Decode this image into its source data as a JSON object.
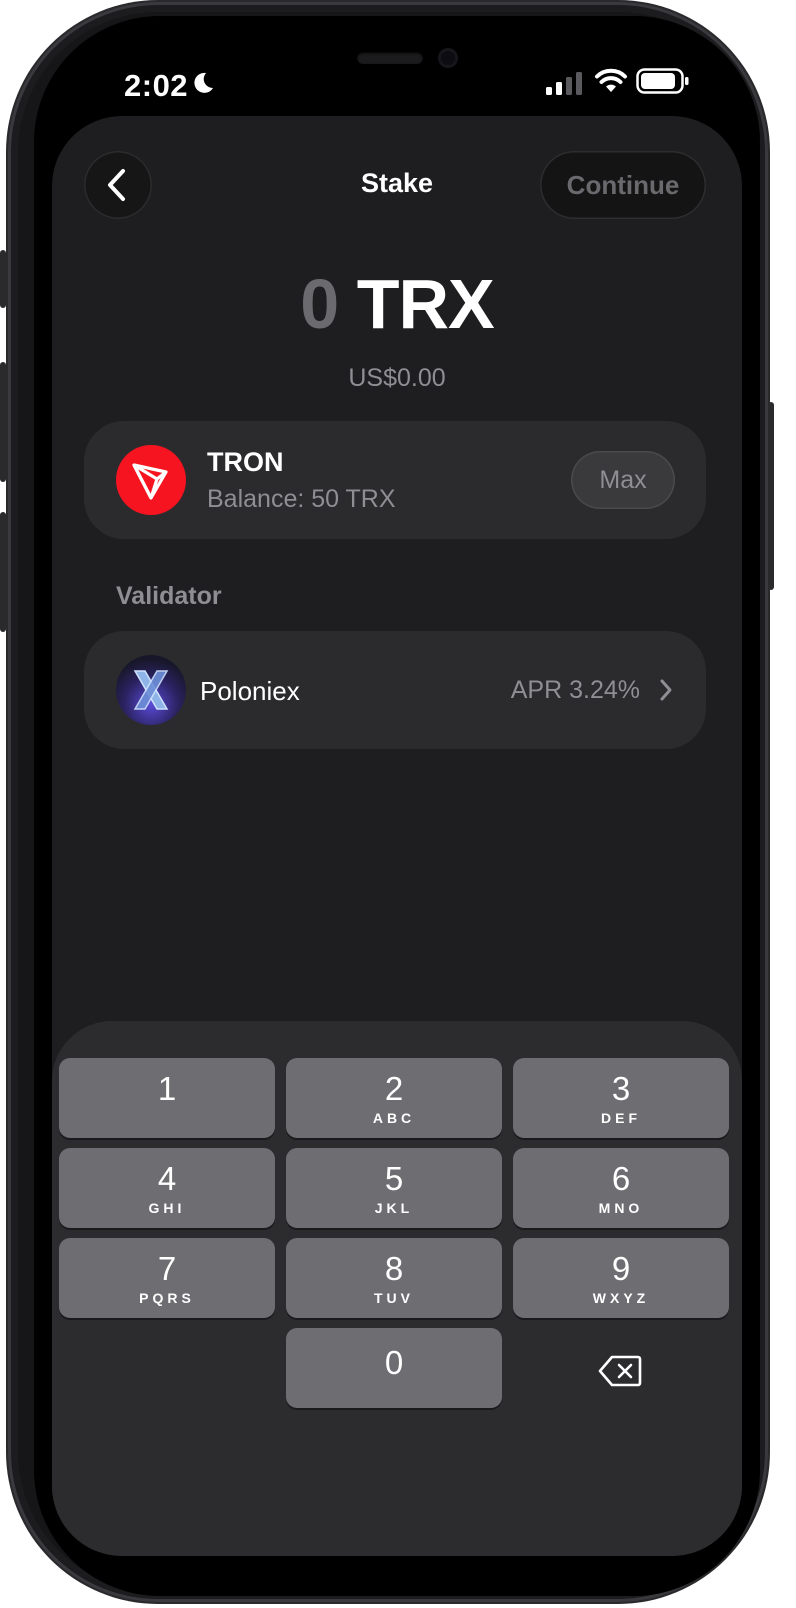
{
  "status_bar": {
    "time": "2:02",
    "icons": [
      "moon-icon",
      "cellular-signal-icon",
      "wifi-icon",
      "battery-icon"
    ]
  },
  "header": {
    "back_icon": "chevron-left-icon",
    "title": "Stake",
    "continue_label": "Continue"
  },
  "amount": {
    "value": "0",
    "unit": "TRX",
    "fiat": "US$0.00"
  },
  "token": {
    "name": "TRON",
    "balance": "Balance: 50 TRX",
    "max_label": "Max",
    "icon": "tron-logo-icon",
    "brand_color": "#f5141f"
  },
  "validator": {
    "section_label": "Validator",
    "name": "Poloniex",
    "apr": "APR 3.24%",
    "icon": "poloniex-logo-icon"
  },
  "keypad": {
    "keys": [
      {
        "num": "1",
        "letters": ""
      },
      {
        "num": "2",
        "letters": "ABC"
      },
      {
        "num": "3",
        "letters": "DEF"
      },
      {
        "num": "4",
        "letters": "GHI"
      },
      {
        "num": "5",
        "letters": "JKL"
      },
      {
        "num": "6",
        "letters": "MNO"
      },
      {
        "num": "7",
        "letters": "PQRS"
      },
      {
        "num": "8",
        "letters": "TUV"
      },
      {
        "num": "9",
        "letters": "WXYZ"
      },
      {
        "num": "0",
        "letters": ""
      }
    ],
    "delete_icon": "backspace-icon"
  },
  "colors": {
    "background": "#000000",
    "sheet": "#1e1e20",
    "card": "#2b2b2e",
    "key": "#6e6e72",
    "muted_text": "#8e8e93"
  }
}
